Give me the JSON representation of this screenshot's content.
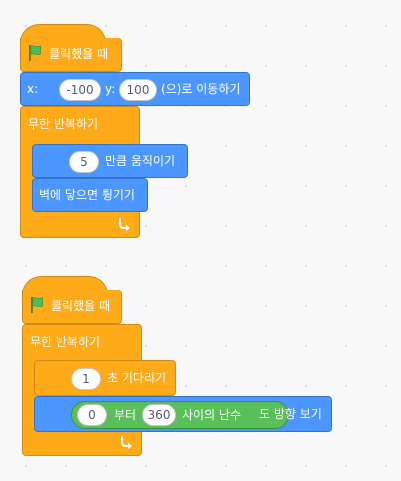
{
  "script1": {
    "hat_label": "클릭했을 때",
    "motion_x_label": "x:",
    "motion_x_value": "-100",
    "motion_y_label": "y:",
    "motion_y_value": "100",
    "motion_goto_suffix": "(으)로 이동하기",
    "forever_label": "무한 반복하기",
    "move_value": "5",
    "move_label": "만큼 움직이기",
    "bounce_label": "벽에 닿으면 튕기기"
  },
  "script2": {
    "hat_label": "클릭했을 때",
    "forever_label": "무한 반복하기",
    "wait_value": "1",
    "wait_label": "초 기다리기",
    "random_from": "0",
    "random_mid_label": "부터",
    "random_to": "360",
    "random_suffix": "사이의 난수",
    "point_suffix": "도 방향 보기"
  },
  "colors": {
    "events": "#ffbf00",
    "control": "#ffab19",
    "motion": "#4c97ff",
    "operators": "#59c059"
  },
  "icons": [
    "green-flag-icon",
    "loop-arrow-icon"
  ]
}
